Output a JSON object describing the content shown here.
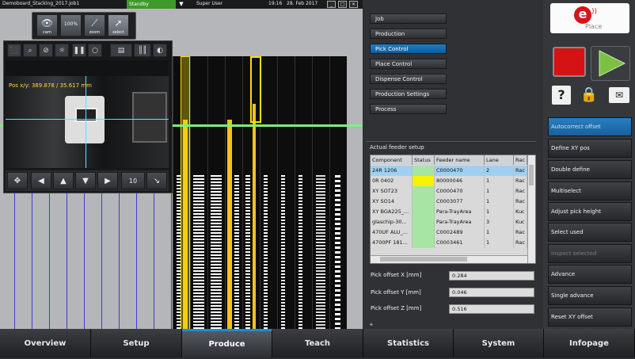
{
  "titlebar": {
    "job": "Demoboard_Stacking_2017.Job1",
    "status": "Standby",
    "user": "Super User",
    "time": "19:16",
    "date": "28. Feb 2017",
    "win_min": "_",
    "win_max": "□",
    "win_close": "✕"
  },
  "toolbar": {
    "tools": [
      {
        "label": "cam",
        "icon": "eye-icon"
      },
      {
        "label": "",
        "icon": "zoom-100-icon",
        "badge": "100%"
      },
      {
        "label": "zoom",
        "icon": "ruler-icon"
      },
      {
        "label": "select",
        "icon": "cursor-icon"
      }
    ]
  },
  "camera": {
    "position": "Pos x/y: 389.878 / 35.617 mm",
    "zoom_step": "10"
  },
  "menu": {
    "items": [
      "Job",
      "Production",
      "Pick Control",
      "Place Control",
      "Dispense Control",
      "Production Settings",
      "Process"
    ],
    "selected": "Pick Control"
  },
  "feeder_setup": {
    "title": "Actual feeder setup",
    "columns": [
      "Component",
      "Status",
      "Feeder name",
      "Lane",
      "Rac"
    ],
    "rows": [
      {
        "component": "24R 1206",
        "status": "",
        "feeder": "C0000470",
        "lane": "2",
        "rack": "Rac",
        "selected": true,
        "status_color": "#a6e6a2"
      },
      {
        "component": "0R 0402",
        "status": "",
        "feeder": "80000046",
        "lane": "1",
        "rack": "Rac",
        "selected": false,
        "status_color": "#f6f200"
      },
      {
        "component": "XY SOT23",
        "status": "",
        "feeder": "C0000470",
        "lane": "1",
        "rack": "Rac",
        "selected": false,
        "status_color": "#a6e6a2"
      },
      {
        "component": "XY SO14",
        "status": "",
        "feeder": "C0003077",
        "lane": "1",
        "rack": "Rac",
        "selected": false,
        "status_color": "#a6e6a2"
      },
      {
        "component": "XY BGA225_...",
        "status": "",
        "feeder": "Para-TrayArea",
        "lane": "1",
        "rack": "Kuc",
        "selected": false,
        "status_color": "#a6e6a2"
      },
      {
        "component": "glaschip-30...",
        "status": "",
        "feeder": "Para-TrayArea",
        "lane": "3",
        "rack": "Kuc",
        "selected": false,
        "status_color": "#a6e6a2"
      },
      {
        "component": "470UF ALU_...",
        "status": "",
        "feeder": "C0002489",
        "lane": "1",
        "rack": "Rac",
        "selected": false,
        "status_color": "#a6e6a2"
      },
      {
        "component": "4700PF 181...",
        "status": "",
        "feeder": "C0003461",
        "lane": "1",
        "rack": "Rac",
        "selected": false,
        "status_color": "#a6e6a2"
      }
    ]
  },
  "pick_offsets": {
    "x_label": "Pick offset X [mm]",
    "x_value": "0.284",
    "y_label": "Pick offset Y [mm]",
    "y_value": "0.046",
    "z_label": "Pick offset Z [mm]",
    "z_value": "0.516"
  },
  "side_buttons": [
    {
      "label": "Autocorrect offset",
      "state": "selected"
    },
    {
      "label": "Define XY pos",
      "state": "normal"
    },
    {
      "label": "Double define",
      "state": "normal"
    },
    {
      "label": "Multiselect",
      "state": "normal"
    },
    {
      "label": "Adjust pick height",
      "state": "normal"
    },
    {
      "label": "Select used",
      "state": "normal"
    },
    {
      "label": "Inspect selected",
      "state": "disabled"
    },
    {
      "label": "Advance",
      "state": "normal"
    },
    {
      "label": "Single advance",
      "state": "normal"
    },
    {
      "label": "Reset XY offset",
      "state": "normal"
    }
  ],
  "logo": {
    "letter": "e",
    "text": "Place"
  },
  "controls": {
    "help": "?",
    "lock_icon": "lock-icon",
    "mail_icon": "mail-icon",
    "stop_color": "#d41414",
    "start_color": "#7ac143"
  },
  "bottom_nav": {
    "tabs": [
      "Overview",
      "Setup",
      "Produce",
      "Teach",
      "Statistics",
      "System",
      "Infopage"
    ],
    "selected": "Produce"
  },
  "colors": {
    "accent": "#1b7ec6",
    "standby": "#3e9a2a",
    "guide_line": "#7cf07c"
  }
}
